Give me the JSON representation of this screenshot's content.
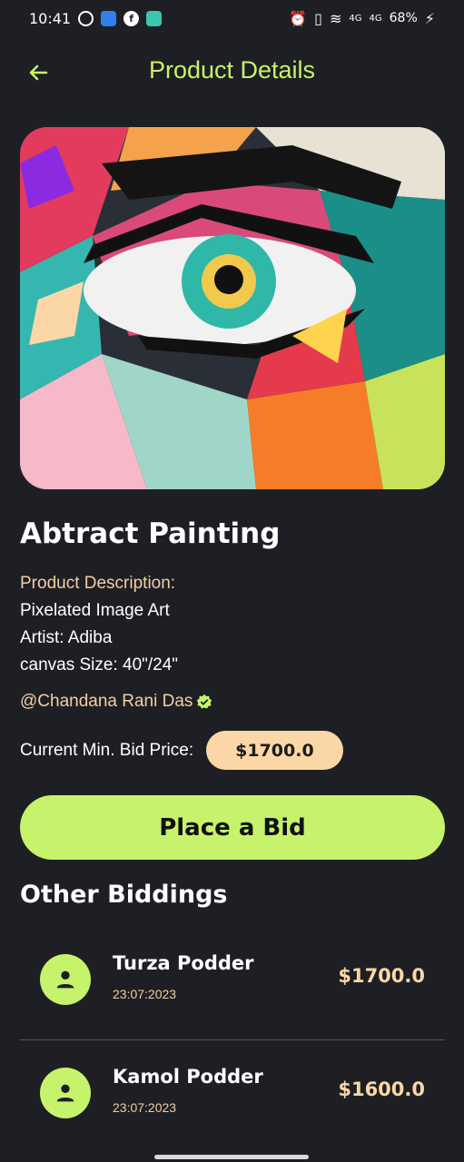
{
  "status_bar": {
    "time": "10:41",
    "network": "4G",
    "network2": "4G",
    "battery": "68%"
  },
  "header": {
    "title": "Product Details",
    "back_icon": "arrow-left-icon"
  },
  "product": {
    "title": "Abtract Painting",
    "description_label": "Product Description:",
    "lines": [
      "Pixelated Image Art",
      "Artist: Adiba",
      "canvas Size: 40\"/24\""
    ],
    "seller": "@Chandana Rani Das",
    "bid_label": "Current Min. Bid Price:",
    "min_bid": "$1700.0"
  },
  "actions": {
    "place_bid": "Place a Bid"
  },
  "other_biddings": {
    "title": "Other Biddings",
    "items": [
      {
        "name": "Turza Podder",
        "date": "23:07:2023",
        "amount": "$1700.0"
      },
      {
        "name": "Kamol Podder",
        "date": "23:07:2023",
        "amount": "$1600.0"
      }
    ]
  },
  "colors": {
    "accent": "#c6f36b",
    "price_pill": "#fbd7a7",
    "background": "#1e1f24"
  }
}
